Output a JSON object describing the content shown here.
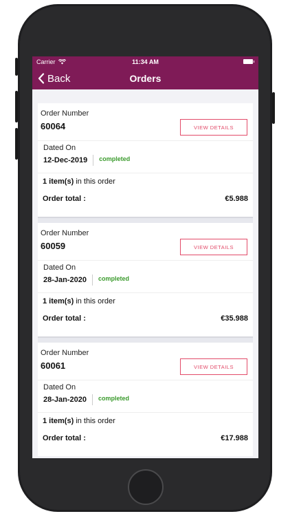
{
  "status_bar": {
    "carrier": "Carrier",
    "time": "11:34 AM"
  },
  "nav": {
    "back_label": "Back",
    "title": "Orders"
  },
  "orders": [
    {
      "number_label": "Order Number",
      "number": "60064",
      "button": "VIEW DETAILS",
      "dated_label": "Dated On",
      "date": "12-Dec-2019",
      "status": "completed",
      "items_count": "1 item(s)",
      "items_suffix": "in this order",
      "total_label": "Order total :",
      "total": "€5.988"
    },
    {
      "number_label": "Order Number",
      "number": "60059",
      "button": "VIEW DETAILS",
      "dated_label": "Dated On",
      "date": "28-Jan-2020",
      "status": "completed",
      "items_count": "1 item(s)",
      "items_suffix": "in this order",
      "total_label": "Order total :",
      "total": "€35.988"
    },
    {
      "number_label": "Order Number",
      "number": "60061",
      "button": "VIEW DETAILS",
      "dated_label": "Dated On",
      "date": "28-Jan-2020",
      "status": "completed",
      "items_count": "1 item(s)",
      "items_suffix": "in this order",
      "total_label": "Order total :",
      "total": "€17.988"
    }
  ],
  "colors": {
    "brand": "#7f1b57",
    "accent": "#e24a68",
    "status_completed": "#3a9a2c"
  },
  "icons": {
    "back": "chevron-left-icon",
    "wifi": "wifi-icon",
    "battery": "battery-icon",
    "home": "home-button"
  }
}
